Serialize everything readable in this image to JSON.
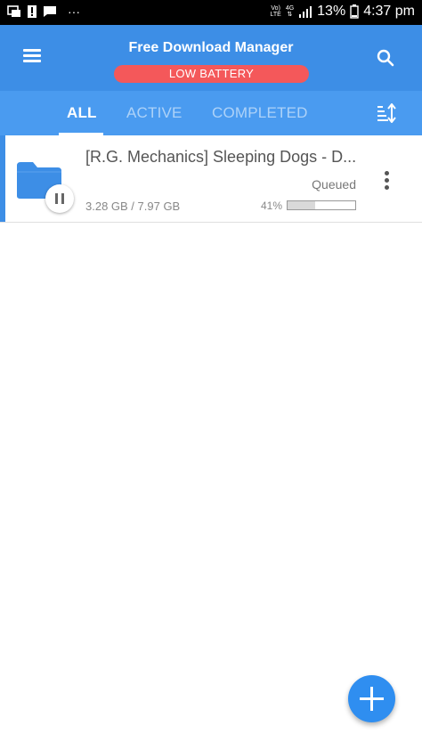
{
  "status_bar": {
    "network_label_top": "Vo)",
    "network_label_bottom": "LTE",
    "data_label": "4G",
    "battery_percent": "13%",
    "time": "4:37 pm",
    "notification_overflow": "···"
  },
  "app_bar": {
    "title": "Free Download Manager",
    "battery_warning": "LOW BATTERY"
  },
  "tabs": [
    {
      "label": "ALL",
      "active": true
    },
    {
      "label": "ACTIVE",
      "active": false
    },
    {
      "label": "COMPLETED",
      "active": false
    }
  ],
  "downloads": [
    {
      "name": "[R.G. Mechanics] Sleeping Dogs - D...",
      "status": "Queued",
      "size": "3.28 GB / 7.97 GB",
      "percent_label": "41%",
      "progress": 0.41
    }
  ],
  "colors": {
    "primary": "#3d8ee6",
    "tab_bar": "#4a9bf0",
    "battery_warning": "#f4585a",
    "fab": "#2f8ef0"
  }
}
